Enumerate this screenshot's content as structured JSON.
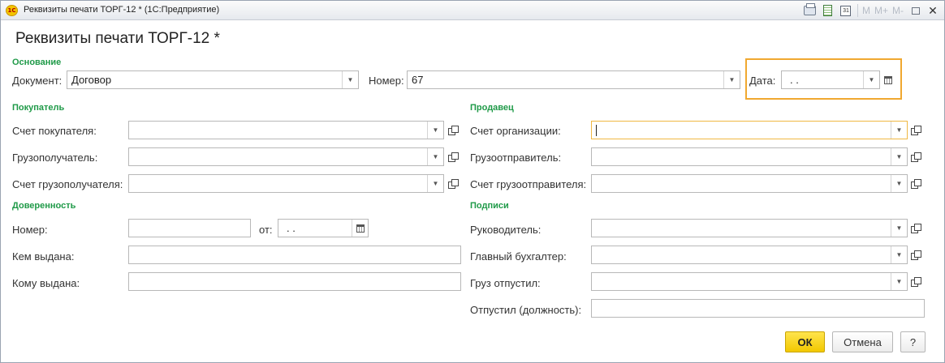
{
  "window": {
    "title": "Реквизиты печати ТОРГ-12 * (1С:Предприятие)",
    "logo_text": "1С",
    "memory_buttons": [
      "M",
      "M+",
      "M-"
    ]
  },
  "form": {
    "title": "Реквизиты печати ТОРГ-12 *"
  },
  "basis": {
    "section": "Основание",
    "document_label": "Документ:",
    "document_value": "Договор",
    "number_label": "Номер:",
    "number_value": "67",
    "date_label": "Дата:",
    "date_value": " .  ."
  },
  "buyer": {
    "section": "Покупатель",
    "account_label": "Счет покупателя:",
    "account_value": "",
    "consignee_label": "Грузополучатель:",
    "consignee_value": "",
    "consignee_account_label": "Счет грузополучателя:",
    "consignee_account_value": ""
  },
  "seller": {
    "section": "Продавец",
    "org_account_label": "Счет организации:",
    "org_account_value": "",
    "shipper_label": "Грузоотправитель:",
    "shipper_value": "",
    "shipper_account_label": "Счет грузоотправителя:",
    "shipper_account_value": ""
  },
  "proxy": {
    "section": "Доверенность",
    "number_label": "Номер:",
    "number_value": "",
    "from_label": "от:",
    "from_value": " .  .",
    "issued_by_label": "Кем выдана:",
    "issued_by_value": "",
    "issued_to_label": "Кому выдана:",
    "issued_to_value": ""
  },
  "signatures": {
    "section": "Подписи",
    "head_label": "Руководитель:",
    "head_value": "",
    "accountant_label": "Главный бухгалтер:",
    "accountant_value": "",
    "released_label": "Груз отпустил:",
    "released_value": "",
    "released_position_label": "Отпустил (должность):",
    "released_position_value": ""
  },
  "buttons": {
    "ok": "ОК",
    "cancel": "Отмена",
    "help": "?"
  },
  "colors": {
    "section_green": "#1f9a48",
    "focus_orange": "#f0a830",
    "ok_yellow": "#f2c800"
  }
}
